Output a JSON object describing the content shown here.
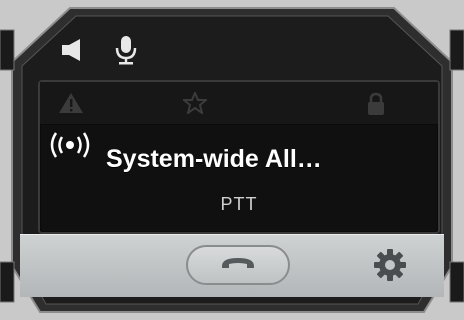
{
  "header": {
    "icons": [
      "speaker-icon",
      "microphone-icon"
    ]
  },
  "status_icons": [
    "warning-icon",
    "star-icon",
    "lock-icon"
  ],
  "alert": {
    "icon": "broadcast-icon",
    "title": "System-wide All…",
    "subtitle": "PTT"
  },
  "controls": {
    "call_icon": "handset-icon",
    "settings_icon": "gear-icon"
  },
  "colors": {
    "bezel": "#1c1c1c",
    "screen": "#101010",
    "control_bar": "#c3c6c8",
    "text": "#ffffff",
    "muted_text": "#cfcfcf"
  }
}
